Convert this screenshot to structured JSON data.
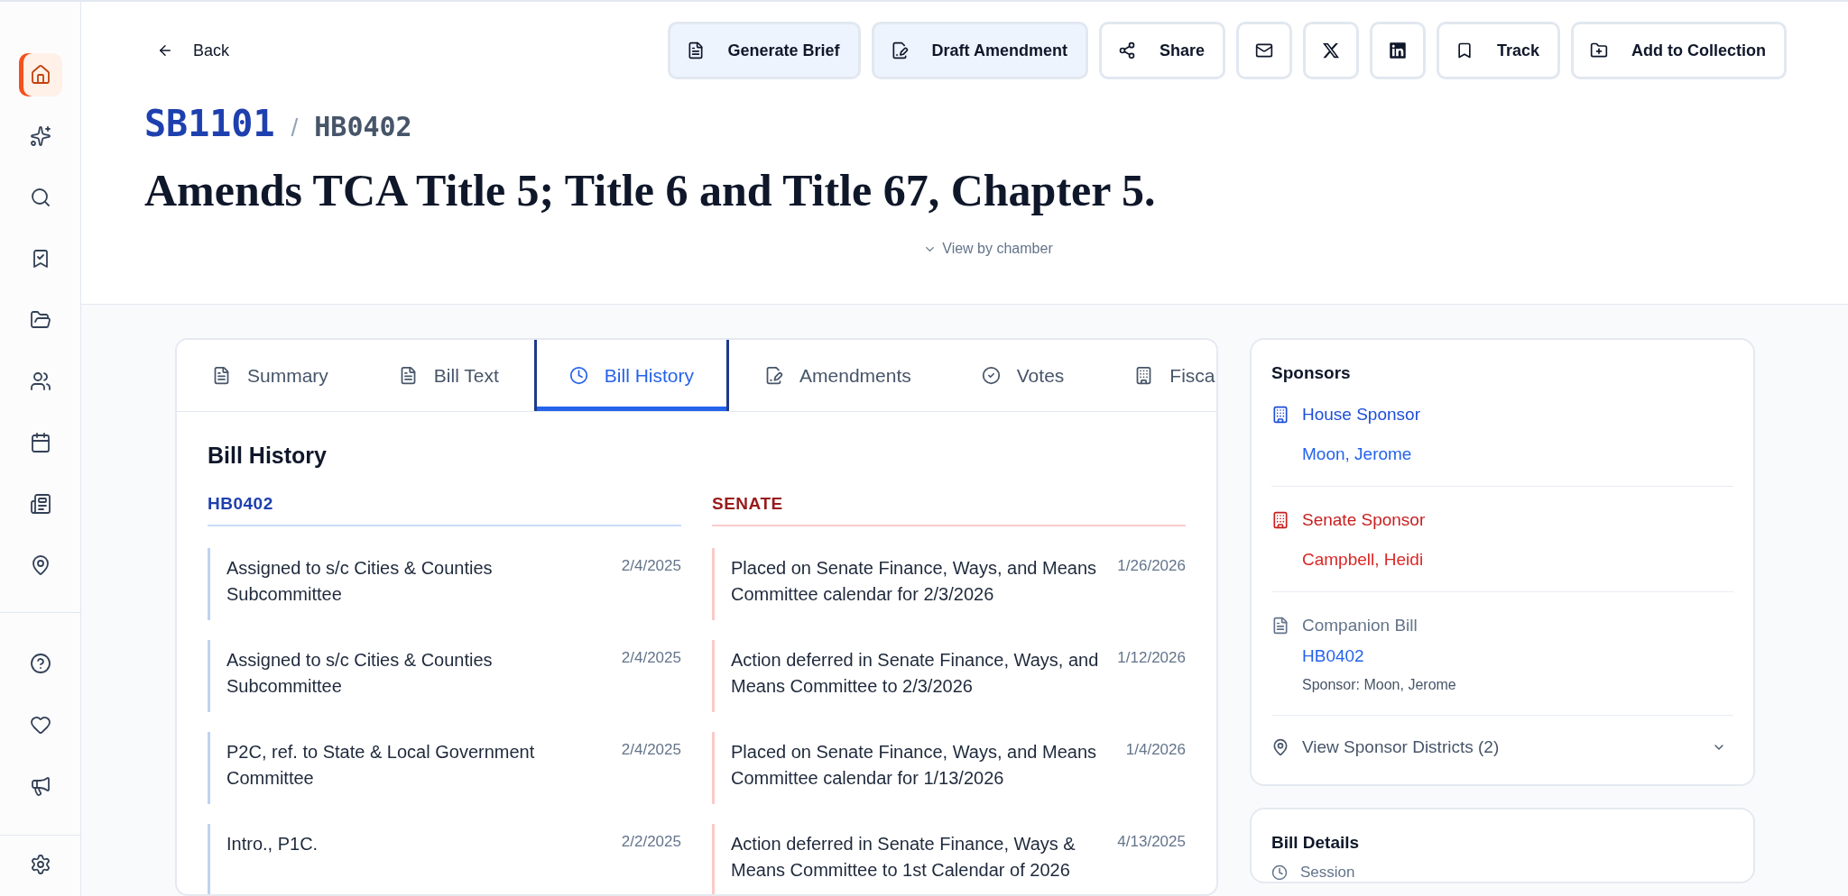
{
  "nav": {
    "items": [
      {
        "selected": true
      },
      {
        "selected": false
      },
      {
        "selected": false
      },
      {
        "selected": false
      },
      {
        "selected": false
      },
      {
        "selected": false
      },
      {
        "selected": false
      },
      {
        "selected": false
      },
      {
        "selected": false
      }
    ],
    "secondary": [
      {
        "selected": false
      },
      {
        "selected": false
      },
      {
        "selected": false
      }
    ],
    "settings": {
      "selected": false
    }
  },
  "back": {
    "label": "Back"
  },
  "actions": [
    {
      "kind": "brief",
      "label": "Generate Brief",
      "highlighted": true
    },
    {
      "kind": "amend",
      "label": "Draft Amendment",
      "highlighted": true
    },
    {
      "kind": "share",
      "label": "Share",
      "highlighted": false
    },
    {
      "kind": "mail",
      "highlighted": false
    },
    {
      "kind": "x",
      "highlighted": false
    },
    {
      "kind": "linkedin",
      "highlighted": false
    },
    {
      "kind": "track",
      "label": "Track",
      "highlighted": false
    },
    {
      "kind": "collection",
      "label": "Add to Collection",
      "highlighted": false
    }
  ],
  "bill": {
    "number": "SB1101",
    "separator": "/",
    "companion": "HB0402",
    "title": "Amends TCA Title 5; Title 6 and Title 67, Chapter 5.",
    "view_toggle": "View by chamber"
  },
  "tabs": [
    {
      "kind": "summary",
      "label": "Summary",
      "selected": false
    },
    {
      "kind": "text",
      "label": "Bill Text",
      "selected": false
    },
    {
      "kind": "history",
      "label": "Bill History",
      "selected": true
    },
    {
      "kind": "amendments",
      "label": "Amendments",
      "selected": false
    },
    {
      "kind": "votes",
      "label": "Votes",
      "selected": false
    },
    {
      "kind": "fiscal",
      "label": "Fisca",
      "selected": false
    }
  ],
  "history": {
    "title": "Bill History",
    "columns": [
      {
        "kind": "house",
        "heading": "HB0402",
        "entries": [
          {
            "text": "Assigned to s/c Cities & Counties Subcommittee",
            "date": "2/4/2025"
          },
          {
            "text": "Assigned to s/c Cities & Counties Subcommittee",
            "date": "2/4/2025"
          },
          {
            "text": "P2C, ref. to State & Local Government Committee",
            "date": "2/4/2025"
          },
          {
            "text": "Intro., P1C.",
            "date": "2/2/2025"
          }
        ]
      },
      {
        "kind": "senate",
        "heading": "SENATE",
        "entries": [
          {
            "text": "Placed on Senate Finance, Ways, and Means Committee calendar for 2/3/2026",
            "date": "1/26/2026"
          },
          {
            "text": "Action deferred in Senate Finance, Ways, and Means Committee to 2/3/2026",
            "date": "1/12/2026"
          },
          {
            "text": "Placed on Senate Finance, Ways, and Means Committee calendar for 1/13/2026",
            "date": "1/4/2026"
          },
          {
            "text": "Action deferred in Senate Finance, Ways & Means Committee to 1st Calendar of 2026",
            "date": "4/13/2025"
          }
        ]
      }
    ]
  },
  "sponsors": {
    "title": "Sponsors",
    "items": [
      {
        "kind": "house",
        "role": "House Sponsor",
        "name": "Moon, Jerome"
      },
      {
        "kind": "senate",
        "role": "Senate Sponsor",
        "name": "Campbell, Heidi"
      }
    ],
    "companion": {
      "label": "Companion Bill",
      "bill": "HB0402",
      "sponsor": "Sponsor: Moon, Jerome"
    },
    "districts": {
      "label": "View Sponsor Districts (2)",
      "expanded": false
    }
  },
  "details": {
    "title": "Bill Details",
    "fields": [
      {
        "label": "Session"
      }
    ]
  }
}
